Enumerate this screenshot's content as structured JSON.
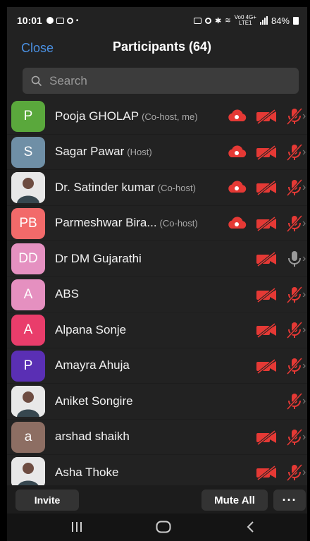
{
  "status": {
    "time": "10:01",
    "network": "Vo0 4G+\nLTE1",
    "battery": "84%"
  },
  "header": {
    "close": "Close",
    "title": "Participants (64)"
  },
  "search": {
    "placeholder": "Search"
  },
  "participants": [
    {
      "initials": "P",
      "color": "#5aa83c",
      "name": "Pooja GHOLAP",
      "role": "(Co-host, me)",
      "cloud": true,
      "video_off": true,
      "muted": true
    },
    {
      "initials": "S",
      "color": "#6f8fa6",
      "name": "Sagar Pawar",
      "role": "(Host)",
      "cloud": true,
      "video_off": true,
      "muted": true
    },
    {
      "initials": "",
      "photo": true,
      "name": "Dr. Satinder kumar",
      "role": "(Co-host)",
      "cloud": true,
      "video_off": true,
      "muted": true
    },
    {
      "initials": "PB",
      "color": "#f26a6a",
      "name": "Parmeshwar Bira...",
      "role": "(Co-host)",
      "cloud": true,
      "video_off": true,
      "muted": true
    },
    {
      "initials": "DD",
      "color": "#e591c1",
      "name": "Dr DM Gujarathi",
      "role": "",
      "cloud": false,
      "video_off": true,
      "muted": false
    },
    {
      "initials": "A",
      "color": "#e590c0",
      "name": "ABS",
      "role": "",
      "cloud": false,
      "video_off": true,
      "muted": true
    },
    {
      "initials": "A",
      "color": "#e93d6b",
      "name": "Alpana Sonje",
      "role": "",
      "cloud": false,
      "video_off": true,
      "muted": true
    },
    {
      "initials": "P",
      "color": "#5a2fb4",
      "name": "Amayra Ahuja",
      "role": "",
      "cloud": false,
      "video_off": true,
      "muted": true
    },
    {
      "initials": "",
      "photo": true,
      "name": "Aniket Songire",
      "role": "",
      "cloud": false,
      "video_off": false,
      "muted": true
    },
    {
      "initials": "a",
      "color": "#8d6e63",
      "name": "arshad shaikh",
      "role": "",
      "cloud": false,
      "video_off": true,
      "muted": true
    },
    {
      "initials": "",
      "photo": true,
      "name": "Asha Thoke",
      "role": "",
      "cloud": false,
      "video_off": true,
      "muted": true
    }
  ],
  "footer": {
    "invite": "Invite",
    "mute_all": "Mute All",
    "more": "···"
  },
  "colors": {
    "accent": "#4a90e2",
    "alert": "#e53935"
  },
  "icons": {
    "cloud": "cloud-record-icon",
    "camera": "video-off-icon",
    "mic_muted": "mic-muted-icon",
    "mic_on": "mic-icon",
    "chevron": "chevron-right-icon"
  }
}
